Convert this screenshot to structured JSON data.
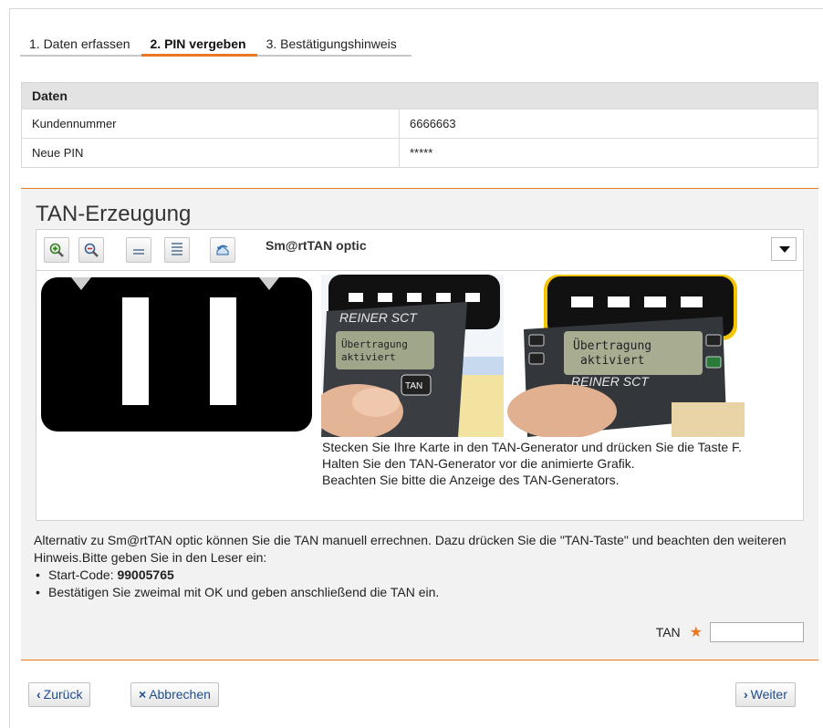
{
  "steps": [
    "1. Daten erfassen",
    "2. PIN vergeben",
    "3. Bestätigungshinweis"
  ],
  "data_table": {
    "header": "Daten",
    "rows": [
      {
        "label": "Kundennummer",
        "value": "6666663"
      },
      {
        "label": "Neue PIN",
        "value": "*****"
      }
    ]
  },
  "tan": {
    "title": "TAN-Erzeugung",
    "toolbar": {
      "icons": [
        "zoom-in-icon",
        "zoom-out-icon",
        "slower-icon",
        "faster-icon",
        "reset-icon"
      ],
      "method": "Sm@rtTAN optic"
    },
    "device_brand": "REINER SCT",
    "device_display": "Übertragung aktiviert",
    "instructions": [
      "Stecken Sie Ihre Karte in den TAN-Generator und drücken Sie die Taste F.",
      "Halten Sie den TAN-Generator vor die animierte Grafik.",
      "Beachten Sie bitte die Anzeige des TAN-Generators."
    ],
    "alternative_text": "Alternativ zu Sm@rtTAN optic können Sie die TAN manuell errechnen. Dazu drücken Sie die \"TAN-Taste\" und beachten den weiteren Hinweis.Bitte geben Sie in den Leser ein:",
    "start_code_label": "Start-Code: ",
    "start_code": "99005765",
    "confirm_text": "Bestätigen Sie zweimal mit OK und geben anschließend die TAN ein.",
    "field_label": "TAN",
    "field_required": "★",
    "field_value": ""
  },
  "buttons": {
    "back": "Zurück",
    "cancel": "Abbrechen",
    "next": "Weiter"
  },
  "colors": {
    "accent": "#e87722",
    "link": "#1f4e8c"
  }
}
